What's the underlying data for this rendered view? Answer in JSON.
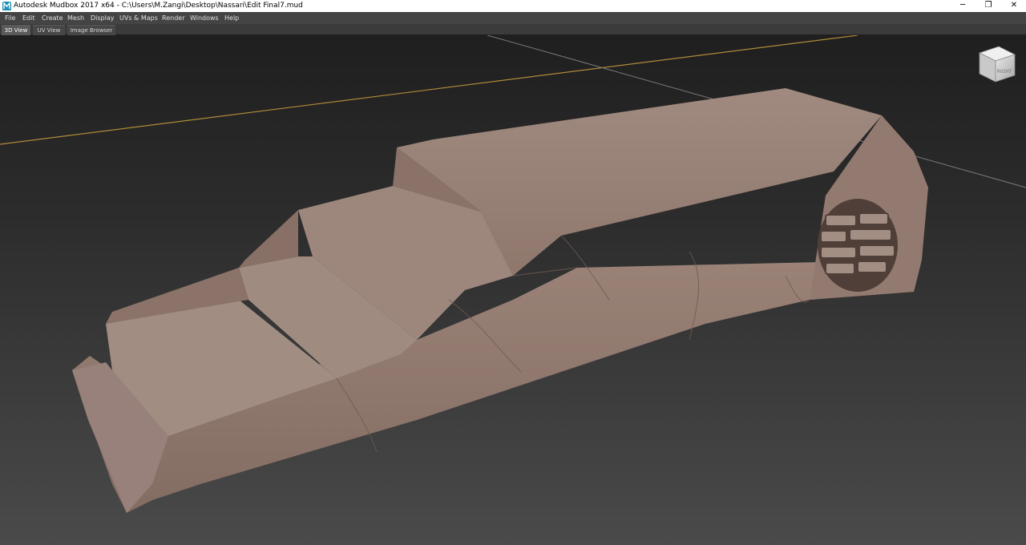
{
  "window": {
    "title": "Autodesk Mudbox 2017 x64 - C:\\Users\\M.Zangi\\Desktop\\Nassari\\Edit Final7.mud",
    "app_icon": "mudbox-logo-icon",
    "controls": {
      "minimize": "─",
      "restore": "❐",
      "close": "✕"
    }
  },
  "menu": [
    "File",
    "Edit",
    "Create",
    "Mesh",
    "Display",
    "UVs & Maps",
    "Render",
    "Windows",
    "Help"
  ],
  "tabs": [
    {
      "label": "3D View",
      "active": true
    },
    {
      "label": "UV View",
      "active": false
    },
    {
      "label": "Image Browser",
      "active": false
    }
  ],
  "viewport": {
    "view_cube_label": "RIGHT",
    "icons": [
      "view-cube-icon"
    ],
    "colors": {
      "background_top": "#1f1f1f",
      "background_bottom": "#4a4a4a",
      "grid_axis_x": "#b08a3a",
      "mesh": "#9a8277",
      "accent": "#2a9fd6"
    }
  }
}
